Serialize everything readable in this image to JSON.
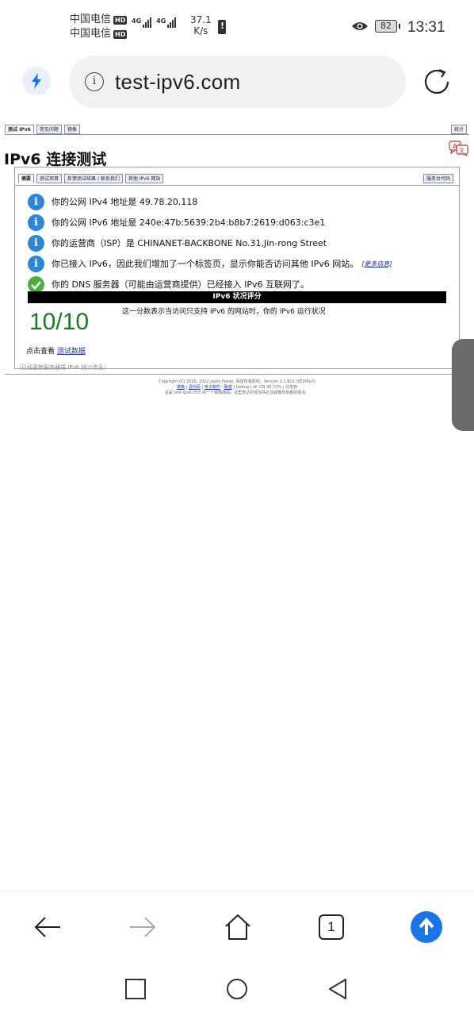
{
  "status_bar": {
    "carrier_1": "中国电信",
    "carrier_2": "中国电信",
    "hd_badge": "HD",
    "network_1": "4G",
    "network_2": "4G",
    "speed_value": "37.1",
    "speed_unit": "K/s",
    "battery": "82",
    "time": "13:31"
  },
  "browser": {
    "url": "test-ipv6.com",
    "tab_count": "1"
  },
  "page": {
    "top_tabs": [
      "测试 IPv6",
      "常见问题",
      "镜像"
    ],
    "top_tab_right": "统计",
    "title": "IPv6 连接测试",
    "sub_tabs": [
      "摘要",
      "测试项目",
      "反馈测试结果 / 联系我们",
      "其他 IPv6 网站"
    ],
    "sub_tab_right": "服务台代码",
    "rows": [
      {
        "icon": "info-icon",
        "text": "你的公网 IPv4 地址是 49.78.20.118"
      },
      {
        "icon": "info-icon",
        "text": "你的公网 IPv6 地址是 240e:47b:5639:2b4:b8b7:2619:d063:c3e1"
      },
      {
        "icon": "info-icon",
        "text": "你的运营商（ISP）是 CHINANET-BACKBONE No.31,Jin-rong Street"
      },
      {
        "icon": "info-icon",
        "text": "你已接入 IPv6，因此我们增加了一个标签页，显示你能否访问其他 IPv6 网站。"
      },
      {
        "icon": "check-icon",
        "text": "你的 DNS 服务器（可能由运营商提供）已经接入 IPv6 互联网了。"
      }
    ],
    "more_info": "[更多信息]",
    "score_header": "IPv6 状况评分",
    "score": "10/10",
    "score_desc": "这一分数表示当访问只支持 IPv6 的网站时，你的 IPv6 运行状况",
    "detail_prefix": "点击查看",
    "detail_link": "测试数据",
    "footer_note": "（已经更新服务器端 IPv6 统计信息）",
    "copyright_line_1": "Copyright (C) 2010, 2022 Jason Fesler. 保留所有权利。Version 1.1.912 (952f6a3)",
    "copyright_line_2_links": [
      "镜像",
      "源代码",
      "电子邮件",
      "致谢"
    ],
    "copyright_line_2_extra": "Debug | ",
    "copyright_line_2_tail": "zh_CN 96.72% | 分享到",
    "copyright_line_3": "这是 test-ipv6.com 的一个镜像网站。这里表达的观点并必及镜像所有者的观点。"
  },
  "colors": {
    "info_blue": "#2d86d6",
    "ok_green": "#4caf3d",
    "score_green": "#1d7a1d",
    "accent_blue": "#1a73e8"
  }
}
